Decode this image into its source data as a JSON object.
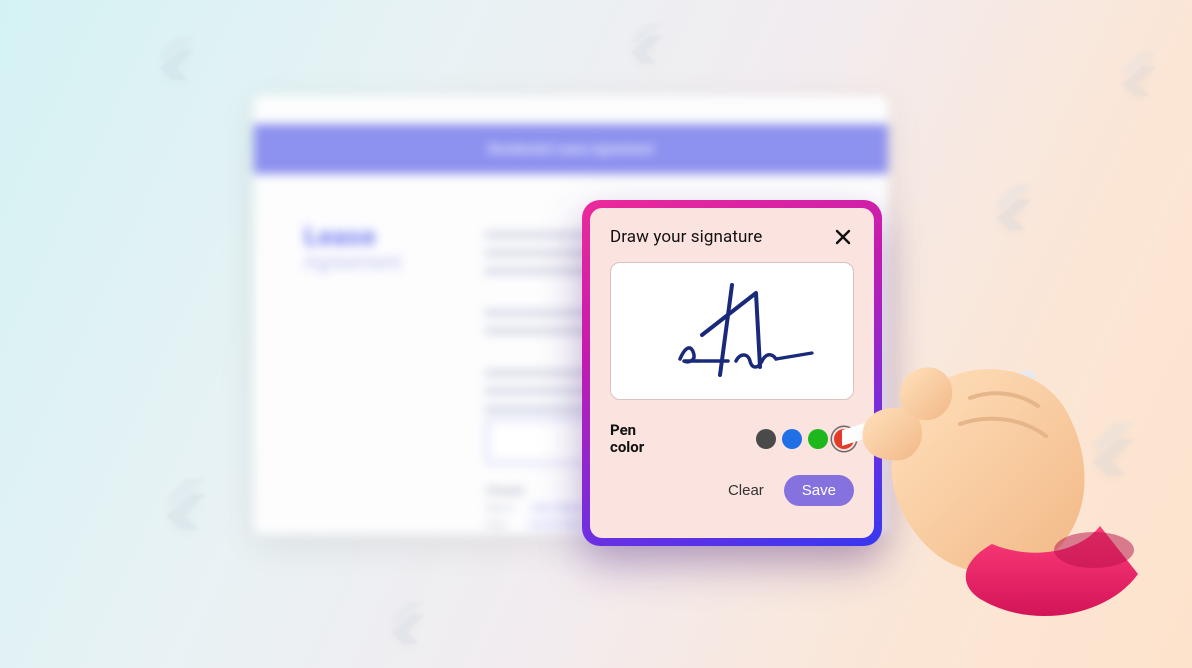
{
  "document": {
    "header_text": "Residential Lease Agreement",
    "title_primary": "Lease",
    "title_secondary": "Agreement",
    "fields_heading": "(Tenant)",
    "name_label": "Name",
    "name_value": "John Adams",
    "date_label": "Date",
    "date_value": "01/01/2024"
  },
  "dialog": {
    "title": "Draw your signature",
    "pen_label_line1": "Pen",
    "pen_label_line2": "color",
    "clear_label": "Clear",
    "save_label": "Save",
    "swatches": {
      "black": "#4a4a4a",
      "blue": "#1f6fe6",
      "green": "#1eb71e",
      "red": "#e23b2a"
    },
    "selected_swatch": "red",
    "signature_stroke_color": "#1a2a7a"
  }
}
